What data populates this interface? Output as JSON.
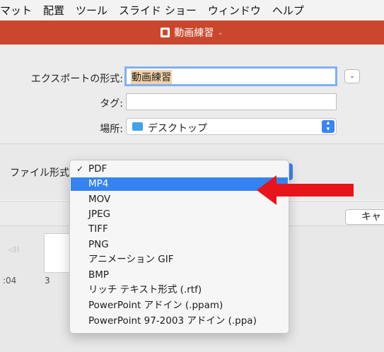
{
  "menubar": {
    "items": [
      "マット",
      "配置",
      "ツール",
      "スライド ショー",
      "ウィンドウ",
      "ヘルプ"
    ]
  },
  "titlebar": {
    "title": "動画練習",
    "chevron": "⌄"
  },
  "export_dialog": {
    "export_as_label": "エクスポートの形式:",
    "export_as_value": "動画練習",
    "tags_label": "タグ:",
    "tags_value": "",
    "where_label": "場所:",
    "where_value": "デスクトップ",
    "file_format_label": "ファイル形式",
    "cancel_label": "キャ"
  },
  "format_menu": {
    "selected": "PDF",
    "highlighted": "MP4",
    "items": [
      {
        "label": "PDF",
        "checked": true
      },
      {
        "label": "MP4"
      },
      {
        "label": "MOV"
      },
      {
        "label": "JPEG"
      },
      {
        "label": "TIFF"
      },
      {
        "label": "PNG"
      },
      {
        "label": "アニメーション GIF"
      },
      {
        "label": "BMP"
      },
      {
        "label": "リッチ テキスト形式 (.rtf)"
      },
      {
        "label": "PowerPoint アドイン (.ppam)"
      },
      {
        "label": "PowerPoint 97-2003 アドイン (.ppa)"
      }
    ]
  },
  "preview": {
    "time": ":04",
    "slide_number": "3"
  },
  "colors": {
    "title_bar": "#c9482d",
    "highlight": "#3583f0",
    "annotation_arrow": "#e8141b"
  }
}
